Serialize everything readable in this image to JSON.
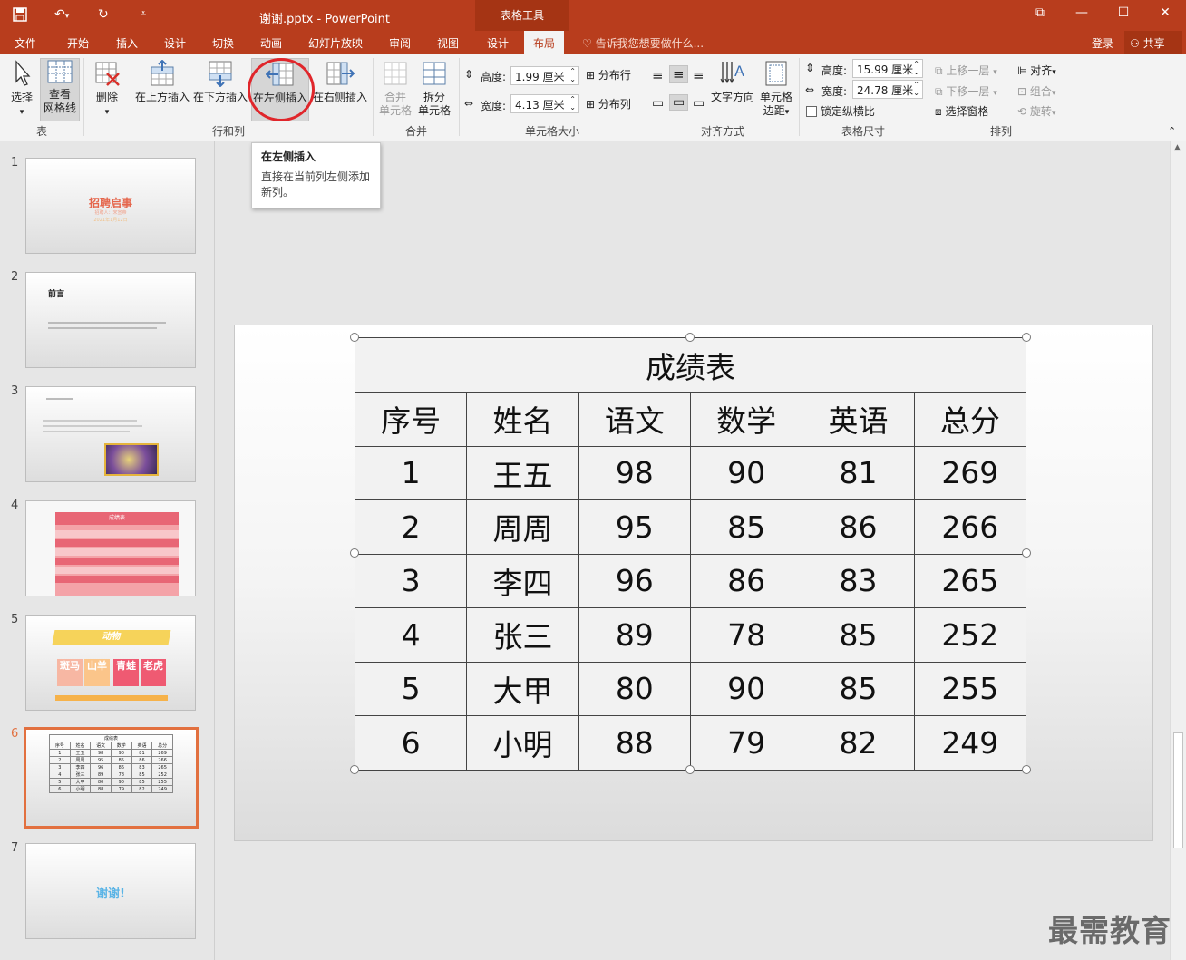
{
  "window": {
    "title": "谢谢.pptx - PowerPoint",
    "context_group": "表格工具",
    "restore_glyph": "⧉",
    "minimize_glyph": "—",
    "maximize_glyph": "☐",
    "close_glyph": "✕"
  },
  "tabs": [
    "文件",
    "开始",
    "插入",
    "设计",
    "切换",
    "动画",
    "幻灯片放映",
    "审阅",
    "视图",
    "设计",
    "布局"
  ],
  "active_tab": "布局",
  "tellme": "告诉我您想要做什么...",
  "login": "登录",
  "share": "共享",
  "ribbon": {
    "groups": {
      "table": "表",
      "rows_cols": "行和列",
      "merge": "合并",
      "cell_size": "单元格大小",
      "align": "对齐方式",
      "table_size": "表格尺寸",
      "arrange": "排列"
    },
    "select": "选择",
    "view_gridlines": "查看网格线",
    "view_gridlines_1": "查看",
    "view_gridlines_2": "网格线",
    "delete": "删除",
    "insert_above": "在上方插入",
    "insert_below": "在下方插入",
    "insert_left": "在左侧插入",
    "insert_right": "在右侧插入",
    "merge_cells_1": "合并",
    "merge_cells_2": "单元格",
    "split_cells_1": "拆分",
    "split_cells_2": "单元格",
    "height_label": "高度:",
    "height_value": "1.99 厘米",
    "width_label": "宽度:",
    "width_value": "4.13 厘米",
    "distribute_rows": "分布行",
    "distribute_cols": "分布列",
    "text_direction": "文字方向",
    "cell_margins_1": "单元格",
    "cell_margins_2": "边距",
    "tbl_height_label": "高度:",
    "tbl_height_value": "15.99 厘米",
    "tbl_width_label": "宽度:",
    "tbl_width_value": "24.78 厘米",
    "lock_ratio": "锁定纵横比",
    "bring_forward": "上移一层",
    "send_backward": "下移一层",
    "selection_pane": "选择窗格",
    "align": "对齐",
    "group": "组合",
    "rotate": "旋转"
  },
  "tooltip": {
    "title": "在左侧插入",
    "body": "直接在当前列左侧添加新列。"
  },
  "thumbnails": [
    {
      "num": "1",
      "title": "招聘启事",
      "sub": "招聘人：宋宣帝",
      "date": "2021年1月12日"
    },
    {
      "num": "2",
      "title": "前言"
    },
    {
      "num": "3"
    },
    {
      "num": "4",
      "title": "成绩表"
    },
    {
      "num": "5",
      "title": "动物",
      "animals": [
        "斑马",
        "山羊",
        "青蛙",
        "老虎"
      ]
    },
    {
      "num": "6",
      "title": "成绩表"
    },
    {
      "num": "7",
      "title": "谢谢!"
    }
  ],
  "table": {
    "caption": "成绩表",
    "headers": [
      "序号",
      "姓名",
      "语文",
      "数学",
      "英语",
      "总分"
    ],
    "rows": [
      [
        "1",
        "王五",
        "98",
        "90",
        "81",
        "269"
      ],
      [
        "2",
        "周周",
        "95",
        "85",
        "86",
        "266"
      ],
      [
        "3",
        "李四",
        "96",
        "86",
        "83",
        "265"
      ],
      [
        "4",
        "张三",
        "89",
        "78",
        "85",
        "252"
      ],
      [
        "5",
        "大甲",
        "80",
        "90",
        "85",
        "255"
      ],
      [
        "6",
        "小明",
        "88",
        "79",
        "82",
        "249"
      ]
    ]
  },
  "watermark": "最需教育",
  "colors": {
    "accent": "#b83d1d",
    "selection": "#e2703f",
    "highlight_circle": "#e0262b"
  }
}
